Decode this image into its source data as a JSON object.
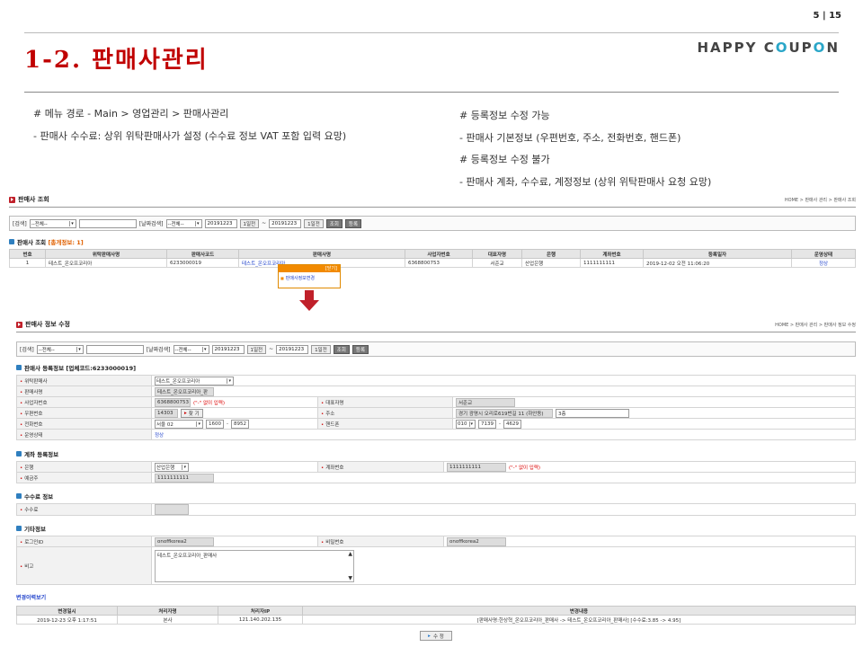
{
  "slide": {
    "page": "5  |  15",
    "title": "1-2. 판매사관리",
    "logo_a": "HAPPY C",
    "logo_b": "O",
    "logo_c": "UP",
    "logo_d": "O",
    "logo_e": "N"
  },
  "notes_left": [
    "# 메뉴 경로 - Main > 영업관리 > 판매사관리",
    "- 판매사 수수료: 상위 위탁판매사가 설정 (수수료 정보 VAT 포함 입력 요망)"
  ],
  "notes_right": [
    "# 등록정보 수정 가능",
    "- 판매사 기본정보 (우편번호, 주소, 전화번호, 핸드폰)",
    "# 등록정보 수정 불가",
    "- 판매사 계좌, 수수료, 계정정보 (상위 위탁판매사 요청 요망)"
  ],
  "search": {
    "label1": "[검색]",
    "sel1": "--전체--",
    "label2": "[날짜검색]",
    "sel2": "--전체--",
    "date1": "20191223",
    "btn_month": "1일전",
    "tilde": "~",
    "date2": "20191223",
    "btn_day": "1일전",
    "btn_search": "조회",
    "btn_reg": "등록"
  },
  "list": {
    "title": "판매사 조회",
    "breadcrumb": "HOME > 판매사 관리 > 판매사 조회",
    "subtitle": "판매사 조회",
    "count": "[총개정보: 1]",
    "headers": [
      "번호",
      "위탁판매사명",
      "판매사코드",
      "판매사명",
      "사업자번호",
      "대표자명",
      "은행",
      "계좌번호",
      "등록일자",
      "운영상태"
    ],
    "row": [
      "1",
      "테스트_온오프코리아",
      "6233000019",
      "테스트_온오프코리아",
      "6368800753",
      "서준교",
      "산업은행",
      "1111111111",
      "2019-12-02 오전 11:06:20",
      "정상"
    ],
    "popup_close": "[닫기]",
    "popup_item": "판매사정보변경"
  },
  "edit": {
    "title": "판매사 정보 수정",
    "breadcrumb": "HOME > 판매사 관리 > 판매사 정보 수정",
    "sec1": "판매사 등록정보 [업체코드:6233000019]",
    "f_consign": "위탁판매사",
    "v_consign": "테스트_온오프코리아",
    "f_name": "판매사명",
    "v_name": "테스트_온오프코리아_판",
    "f_biz": "사업자번호",
    "v_biz": "6368800753",
    "hint": "(\"-\" 없이 입력)",
    "f_ceo": "대표자명",
    "v_ceo": "서준교",
    "f_zip": "우편번호",
    "v_zip": "14303",
    "btn_zip": "찾 기",
    "f_addr": "주소",
    "v_addr": "경기 광명시 오리로619번길 11 (하안동)",
    "v_addr2": "3층",
    "f_tel": "전화번호",
    "v_tel1": "서울 02",
    "v_tel2": "1600",
    "v_tel3": "8952",
    "f_hp": "핸드폰",
    "v_hp1": "010",
    "v_hp2": "7139",
    "v_hp3": "4629",
    "f_status": "운영상태",
    "v_status": "정상",
    "sec2": "계좌 등록정보",
    "f_bank": "은행",
    "v_bank": "산업은행",
    "f_acct": "계좌번호",
    "v_acct": "1111111111",
    "f_holder": "예금주",
    "v_holder": "1111111111",
    "sec3": "수수료 정보",
    "f_fee": "수수료",
    "sec4": "기타정보",
    "f_login": "로그인ID",
    "v_login": "onoffkorea2",
    "f_pw": "비밀번호",
    "v_pw": "onoffkorea2",
    "f_memo": "비고",
    "v_memo": "테스트_온오프코리아_판매사",
    "hist_title": "변경이력보기",
    "hist_headers": [
      "변경일시",
      "처리자명",
      "처리자IP",
      "변경내용"
    ],
    "hist_row": [
      "2019-12-23 오후 1:17:51",
      "본사",
      "121.140.202.135",
      "[판매사명:한상혁_온오프코리아_판매사 -> 테스트_온오프코리아_판매사] [수수료:3.85 -> 4.95]"
    ],
    "btn_modify": "수 정"
  }
}
